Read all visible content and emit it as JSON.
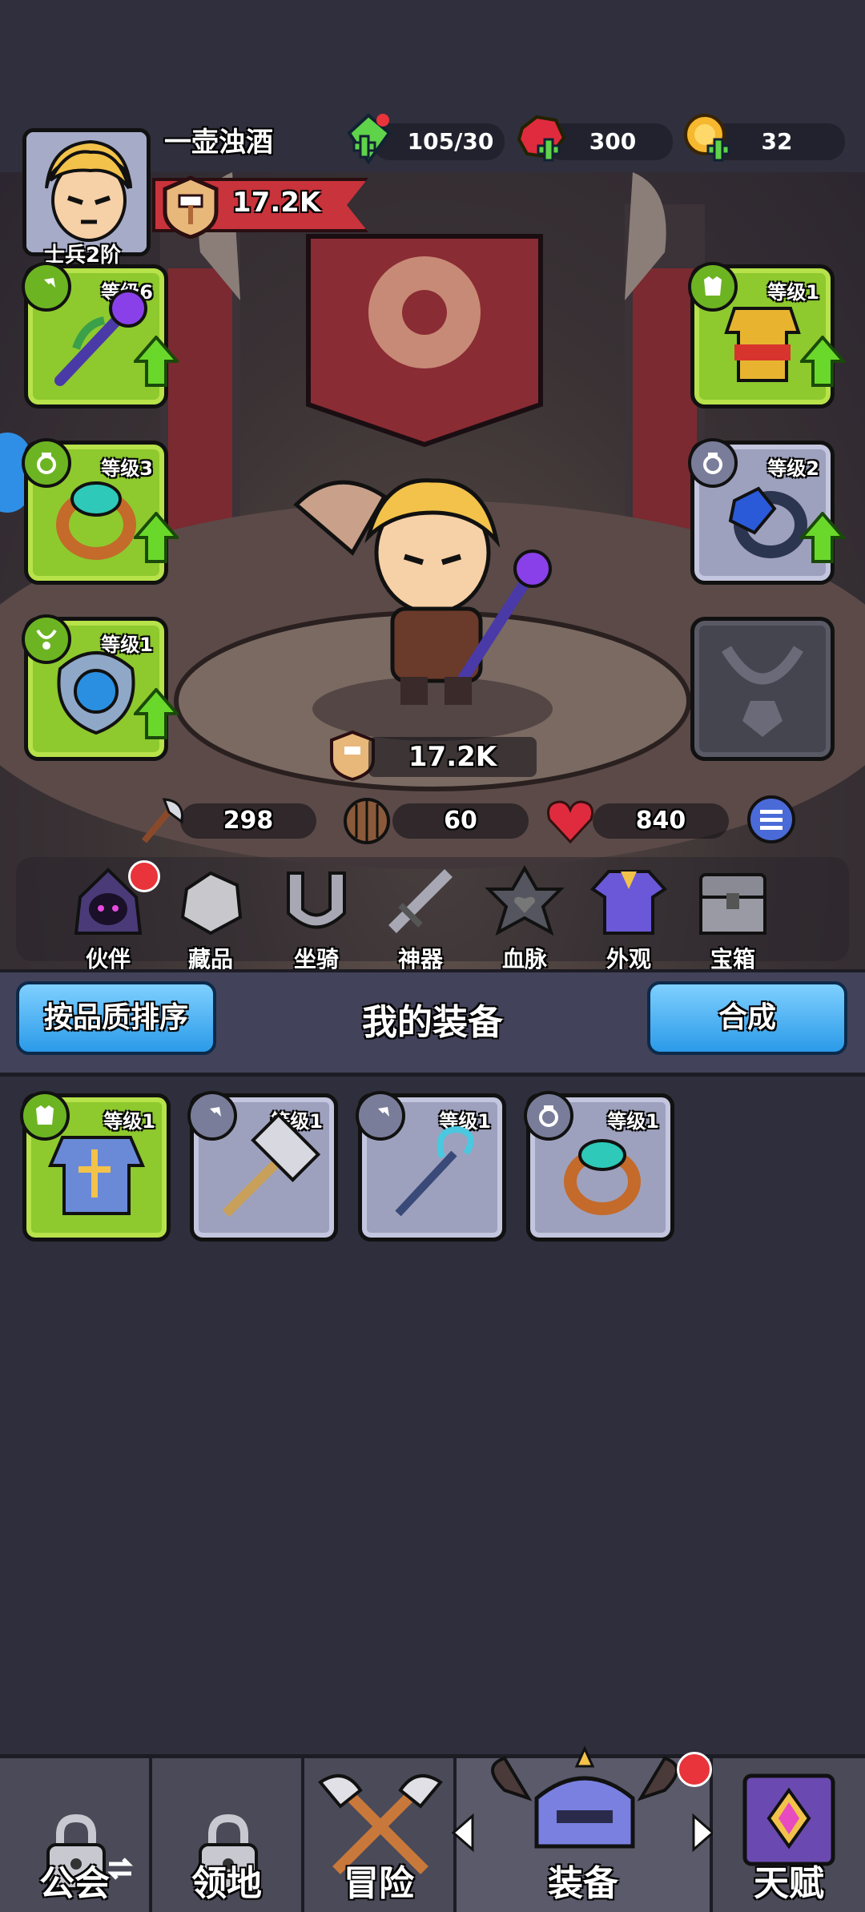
{
  "header": {
    "player_name": "一壶浊酒",
    "rank": "士兵2阶",
    "power": "17.2K",
    "currencies": [
      {
        "name": "stamina",
        "value": "105/30"
      },
      {
        "name": "ruby",
        "value": "300"
      },
      {
        "name": "gold",
        "value": "32"
      }
    ]
  },
  "equipment_slots": {
    "left": [
      {
        "slot": "weapon",
        "level": "等级6"
      },
      {
        "slot": "ring",
        "level": "等级3"
      },
      {
        "slot": "necklace",
        "level": "等级1"
      }
    ],
    "right": [
      {
        "slot": "armor",
        "level": "等级1"
      },
      {
        "slot": "ring",
        "level": "等级2"
      },
      {
        "slot": "necklace",
        "level": ""
      }
    ]
  },
  "hero": {
    "power": "17.2K",
    "attack": "298",
    "defense": "60",
    "hp": "840"
  },
  "feature_menu": [
    {
      "label": "伙伴"
    },
    {
      "label": "藏品"
    },
    {
      "label": "坐骑"
    },
    {
      "label": "神器"
    },
    {
      "label": "血脉"
    },
    {
      "label": "外观"
    },
    {
      "label": "宝箱"
    }
  ],
  "inventory": {
    "title": "我的装备",
    "sort_button": "按品质排序",
    "merge_button": "合成",
    "items": [
      {
        "type": "armor",
        "level": "等级1",
        "rarity": "green"
      },
      {
        "type": "hammer",
        "level": "等级1",
        "rarity": "gray"
      },
      {
        "type": "staff",
        "level": "等级1",
        "rarity": "gray"
      },
      {
        "type": "ring",
        "level": "等级1",
        "rarity": "gray"
      }
    ]
  },
  "bottom_nav": [
    {
      "label": "公会",
      "locked": true
    },
    {
      "label": "领地",
      "locked": true
    },
    {
      "label": "冒险",
      "locked": false
    },
    {
      "label": "装备",
      "locked": false,
      "active": true
    },
    {
      "label": "天赋",
      "locked": false
    }
  ],
  "colors": {
    "rarity_green": "#8ec92e",
    "rarity_gray": "#9ea1bd",
    "button_blue": "#2b9ae8",
    "badge_red": "#e8343a"
  }
}
